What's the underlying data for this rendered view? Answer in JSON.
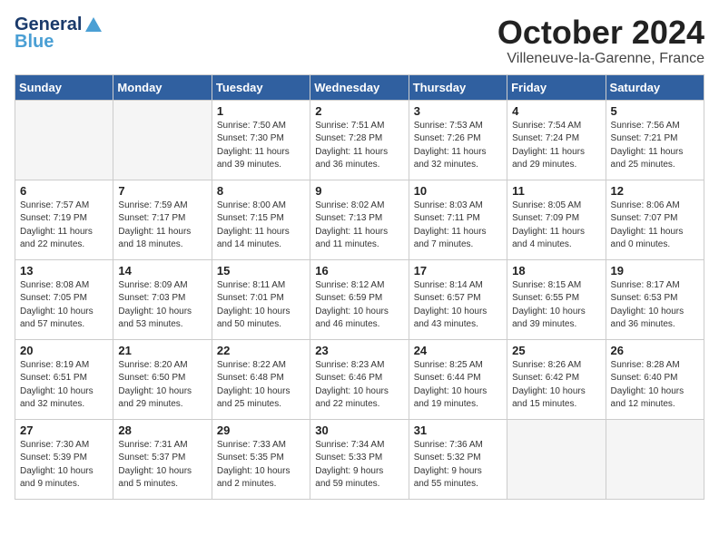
{
  "logo": {
    "line1": "General",
    "line2": "Blue"
  },
  "title": "October 2024",
  "location": "Villeneuve-la-Garenne, France",
  "days_of_week": [
    "Sunday",
    "Monday",
    "Tuesday",
    "Wednesday",
    "Thursday",
    "Friday",
    "Saturday"
  ],
  "weeks": [
    [
      {
        "day": "",
        "info": ""
      },
      {
        "day": "",
        "info": ""
      },
      {
        "day": "1",
        "info": "Sunrise: 7:50 AM\nSunset: 7:30 PM\nDaylight: 11 hours\nand 39 minutes."
      },
      {
        "day": "2",
        "info": "Sunrise: 7:51 AM\nSunset: 7:28 PM\nDaylight: 11 hours\nand 36 minutes."
      },
      {
        "day": "3",
        "info": "Sunrise: 7:53 AM\nSunset: 7:26 PM\nDaylight: 11 hours\nand 32 minutes."
      },
      {
        "day": "4",
        "info": "Sunrise: 7:54 AM\nSunset: 7:24 PM\nDaylight: 11 hours\nand 29 minutes."
      },
      {
        "day": "5",
        "info": "Sunrise: 7:56 AM\nSunset: 7:21 PM\nDaylight: 11 hours\nand 25 minutes."
      }
    ],
    [
      {
        "day": "6",
        "info": "Sunrise: 7:57 AM\nSunset: 7:19 PM\nDaylight: 11 hours\nand 22 minutes."
      },
      {
        "day": "7",
        "info": "Sunrise: 7:59 AM\nSunset: 7:17 PM\nDaylight: 11 hours\nand 18 minutes."
      },
      {
        "day": "8",
        "info": "Sunrise: 8:00 AM\nSunset: 7:15 PM\nDaylight: 11 hours\nand 14 minutes."
      },
      {
        "day": "9",
        "info": "Sunrise: 8:02 AM\nSunset: 7:13 PM\nDaylight: 11 hours\nand 11 minutes."
      },
      {
        "day": "10",
        "info": "Sunrise: 8:03 AM\nSunset: 7:11 PM\nDaylight: 11 hours\nand 7 minutes."
      },
      {
        "day": "11",
        "info": "Sunrise: 8:05 AM\nSunset: 7:09 PM\nDaylight: 11 hours\nand 4 minutes."
      },
      {
        "day": "12",
        "info": "Sunrise: 8:06 AM\nSunset: 7:07 PM\nDaylight: 11 hours\nand 0 minutes."
      }
    ],
    [
      {
        "day": "13",
        "info": "Sunrise: 8:08 AM\nSunset: 7:05 PM\nDaylight: 10 hours\nand 57 minutes."
      },
      {
        "day": "14",
        "info": "Sunrise: 8:09 AM\nSunset: 7:03 PM\nDaylight: 10 hours\nand 53 minutes."
      },
      {
        "day": "15",
        "info": "Sunrise: 8:11 AM\nSunset: 7:01 PM\nDaylight: 10 hours\nand 50 minutes."
      },
      {
        "day": "16",
        "info": "Sunrise: 8:12 AM\nSunset: 6:59 PM\nDaylight: 10 hours\nand 46 minutes."
      },
      {
        "day": "17",
        "info": "Sunrise: 8:14 AM\nSunset: 6:57 PM\nDaylight: 10 hours\nand 43 minutes."
      },
      {
        "day": "18",
        "info": "Sunrise: 8:15 AM\nSunset: 6:55 PM\nDaylight: 10 hours\nand 39 minutes."
      },
      {
        "day": "19",
        "info": "Sunrise: 8:17 AM\nSunset: 6:53 PM\nDaylight: 10 hours\nand 36 minutes."
      }
    ],
    [
      {
        "day": "20",
        "info": "Sunrise: 8:19 AM\nSunset: 6:51 PM\nDaylight: 10 hours\nand 32 minutes."
      },
      {
        "day": "21",
        "info": "Sunrise: 8:20 AM\nSunset: 6:50 PM\nDaylight: 10 hours\nand 29 minutes."
      },
      {
        "day": "22",
        "info": "Sunrise: 8:22 AM\nSunset: 6:48 PM\nDaylight: 10 hours\nand 25 minutes."
      },
      {
        "day": "23",
        "info": "Sunrise: 8:23 AM\nSunset: 6:46 PM\nDaylight: 10 hours\nand 22 minutes."
      },
      {
        "day": "24",
        "info": "Sunrise: 8:25 AM\nSunset: 6:44 PM\nDaylight: 10 hours\nand 19 minutes."
      },
      {
        "day": "25",
        "info": "Sunrise: 8:26 AM\nSunset: 6:42 PM\nDaylight: 10 hours\nand 15 minutes."
      },
      {
        "day": "26",
        "info": "Sunrise: 8:28 AM\nSunset: 6:40 PM\nDaylight: 10 hours\nand 12 minutes."
      }
    ],
    [
      {
        "day": "27",
        "info": "Sunrise: 7:30 AM\nSunset: 5:39 PM\nDaylight: 10 hours\nand 9 minutes."
      },
      {
        "day": "28",
        "info": "Sunrise: 7:31 AM\nSunset: 5:37 PM\nDaylight: 10 hours\nand 5 minutes."
      },
      {
        "day": "29",
        "info": "Sunrise: 7:33 AM\nSunset: 5:35 PM\nDaylight: 10 hours\nand 2 minutes."
      },
      {
        "day": "30",
        "info": "Sunrise: 7:34 AM\nSunset: 5:33 PM\nDaylight: 9 hours\nand 59 minutes."
      },
      {
        "day": "31",
        "info": "Sunrise: 7:36 AM\nSunset: 5:32 PM\nDaylight: 9 hours\nand 55 minutes."
      },
      {
        "day": "",
        "info": ""
      },
      {
        "day": "",
        "info": ""
      }
    ]
  ]
}
